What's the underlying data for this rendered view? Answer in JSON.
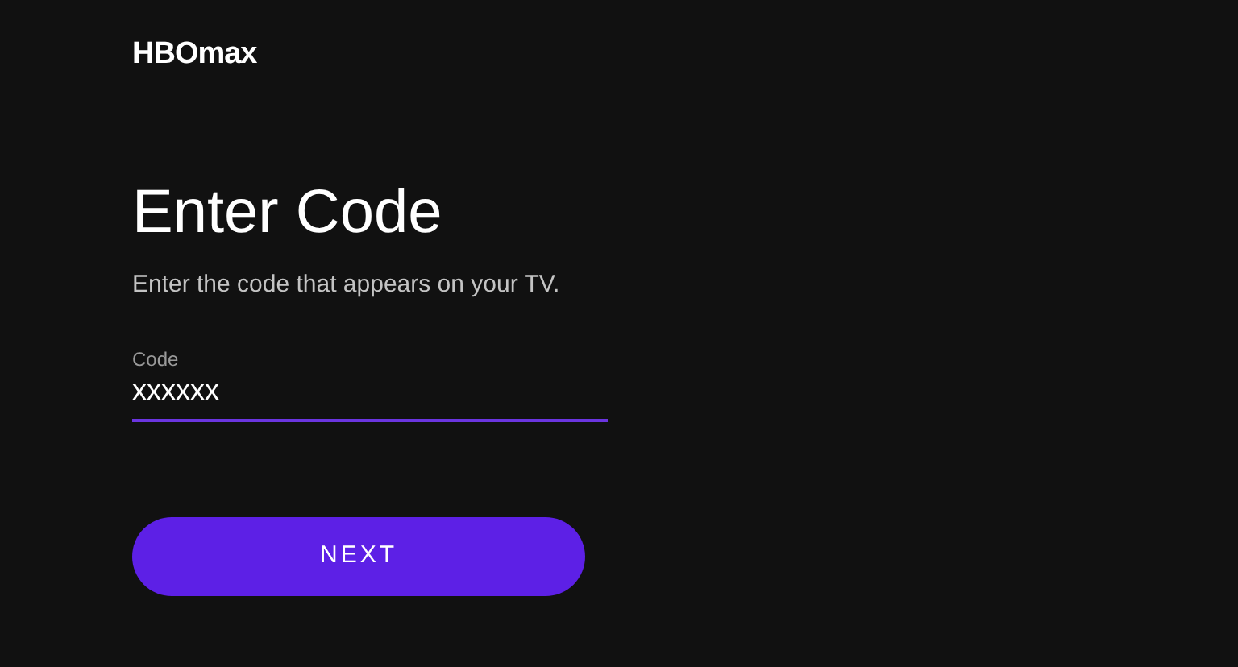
{
  "logo": {
    "text": "HBOmax"
  },
  "heading": "Enter Code",
  "instructions": "Enter the code that appears on your TV.",
  "code_field": {
    "label": "Code",
    "value": "xxxxxx",
    "focused": true
  },
  "next_button": {
    "label": "NEXT"
  }
}
